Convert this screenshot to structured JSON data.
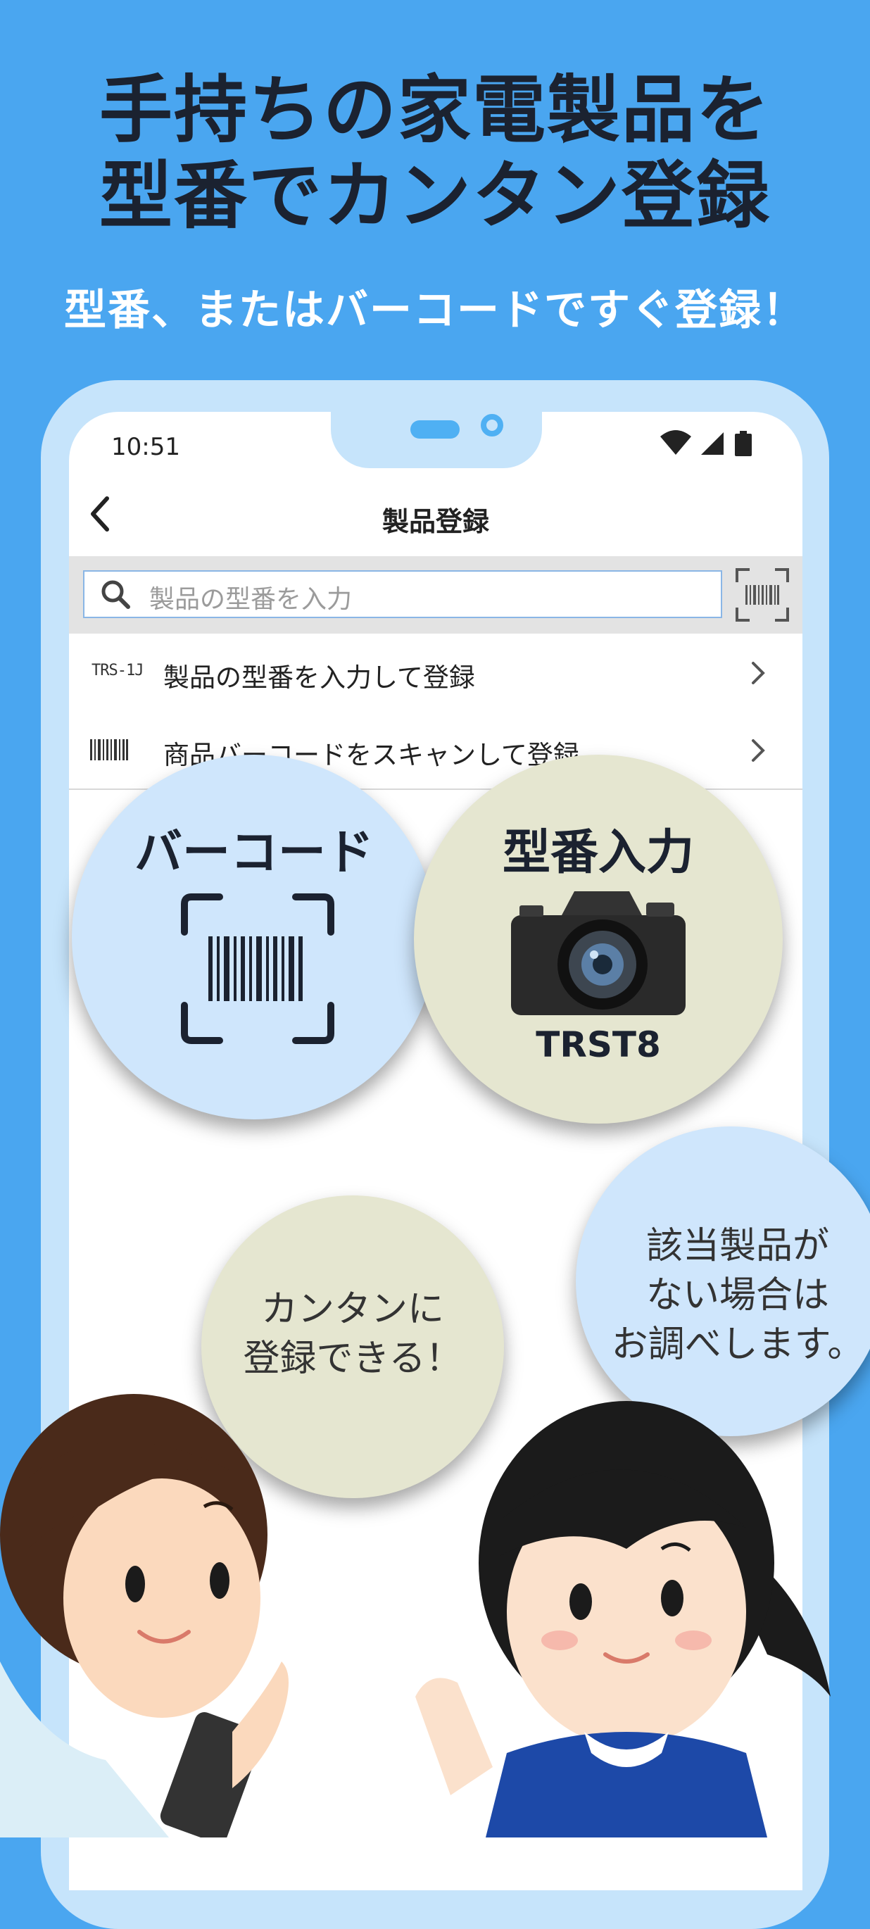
{
  "promo": {
    "headline_line1": "手持ちの家電製品を",
    "headline_line2": "型番でカンタン登録",
    "subheadline": "型番、またはバーコードですぐ登録！"
  },
  "status_bar": {
    "time": "10:51",
    "icons": [
      "wifi-icon",
      "signal-icon",
      "battery-icon"
    ]
  },
  "nav": {
    "title": "製品登録"
  },
  "search": {
    "placeholder": "製品の型番を入力"
  },
  "rows": [
    {
      "icon_text": "TRS-1J",
      "label": "製品の型番を入力して登録"
    },
    {
      "icon": "barcode-icon",
      "label": "商品バーコードをスキャンして登録"
    }
  ],
  "bubbles": {
    "barcode_title": "バーコード",
    "model_title": "型番入力",
    "model_code": "TRST8",
    "easy_line1": "カンタンに",
    "easy_line2": "登録できる！",
    "none_line1": "該当製品が",
    "none_line2": "ない場合は",
    "none_line3": "お調べします。"
  },
  "colors": {
    "background": "#4aa6f0",
    "phone_frame": "#c6e4fb",
    "bubble_blue": "#cfe6fc",
    "bubble_beige": "#e5e6d0",
    "headline": "#1b2230"
  }
}
